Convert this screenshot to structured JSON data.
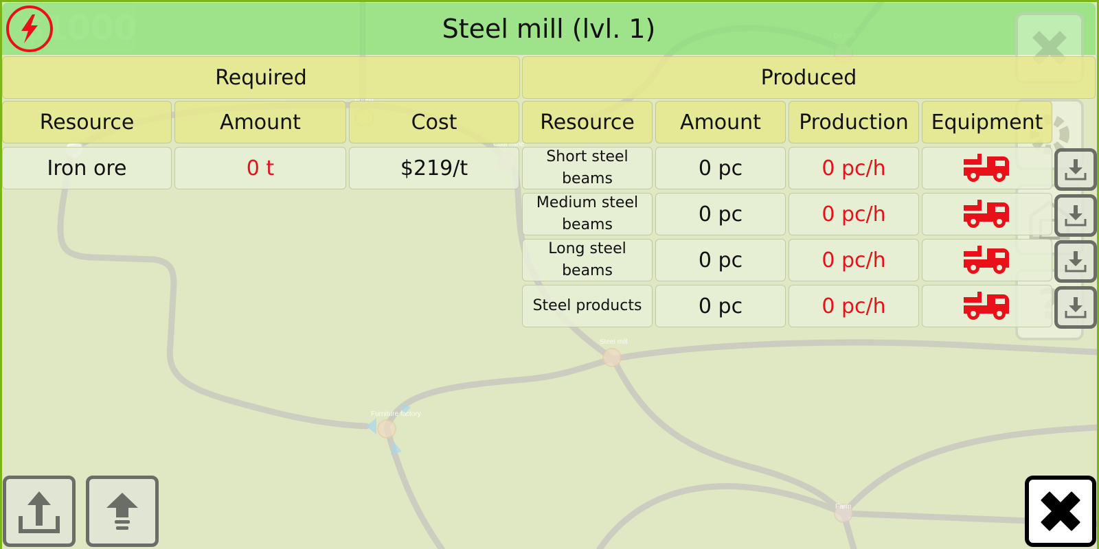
{
  "hud": {
    "money": "$1000"
  },
  "window": {
    "title": "Steel mill (lvl. 1)"
  },
  "map_labels": {
    "oil_well": "Oil well",
    "forest": "Forest",
    "coal_mine": "Coal mine",
    "steel_mill": "Steel mill",
    "furniture_factory": "Furniture factory",
    "farm": "Farm"
  },
  "required": {
    "heading": "Required",
    "columns": [
      "Resource",
      "Amount",
      "Cost"
    ],
    "rows": [
      {
        "resource": "Iron ore",
        "amount": "0 t",
        "cost": "$219/t"
      }
    ]
  },
  "produced": {
    "heading": "Produced",
    "columns": [
      "Resource",
      "Amount",
      "Production",
      "Equipment"
    ],
    "rows": [
      {
        "resource": "Short steel beams",
        "amount": "0 pc",
        "production": "0 pc/h",
        "equipment": "truck-icon"
      },
      {
        "resource": "Medium steel beams",
        "amount": "0 pc",
        "production": "0 pc/h",
        "equipment": "truck-icon"
      },
      {
        "resource": "Long steel beams",
        "amount": "0 pc",
        "production": "0 pc/h",
        "equipment": "truck-icon"
      },
      {
        "resource": "Steel products",
        "amount": "0 pc",
        "production": "0 pc/h",
        "equipment": "truck-icon"
      }
    ]
  },
  "colors": {
    "alert_red": "#e8111a",
    "header_green": "#8ce178",
    "header_yellow": "#e6e88c"
  }
}
